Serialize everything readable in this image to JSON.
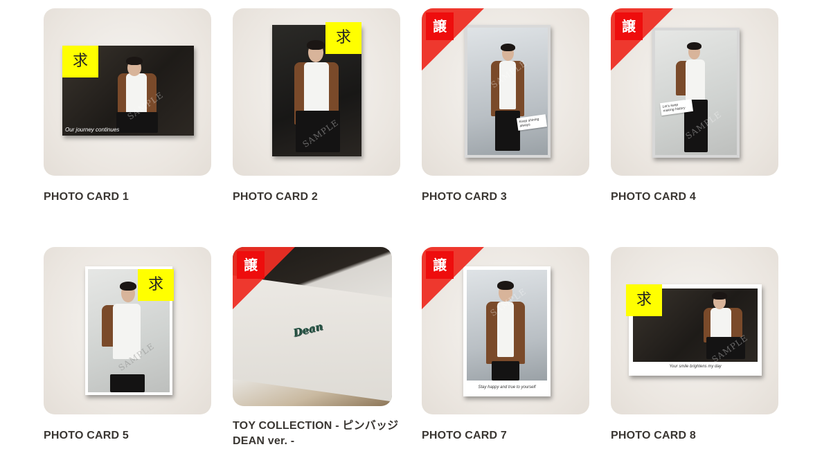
{
  "products": [
    {
      "title": "PHOTO CARD 1",
      "badge": "求",
      "badge_type": "want",
      "caption": "Our journey continues",
      "watermark": "SAMPLE"
    },
    {
      "title": "PHOTO CARD 2",
      "badge": "求",
      "badge_type": "want",
      "caption": "",
      "watermark": "SAMPLE"
    },
    {
      "title": "PHOTO CARD 3",
      "badge": "譲",
      "badge_type": "give",
      "caption": "Keep shining always",
      "watermark": "SAMPLE"
    },
    {
      "title": "PHOTO CARD 4",
      "badge": "譲",
      "badge_type": "give",
      "caption": "Let's keep making history",
      "watermark": "SAMPLE"
    },
    {
      "title": "PHOTO CARD 5",
      "badge": "求",
      "badge_type": "want",
      "caption": "",
      "watermark": "SAMPLE"
    },
    {
      "title": "TOY COLLECTION - ピンバッジ DEAN ver. -",
      "badge": "譲",
      "badge_type": "give",
      "caption": "",
      "pin_text": "Dean",
      "watermark": ""
    },
    {
      "title": "PHOTO CARD 7",
      "badge": "譲",
      "badge_type": "give",
      "caption": "Stay happy and true to yourself",
      "watermark": "SAMPLE"
    },
    {
      "title": "PHOTO CARD 8",
      "badge": "求",
      "badge_type": "want",
      "caption": "Your smile brightens my day",
      "watermark": "SAMPLE"
    }
  ],
  "colors": {
    "want_badge": "#ffff00",
    "give_badge": "#ee0d0d",
    "give_ribbon": "#ee2e24",
    "tile_bg": "#ebe6e0",
    "title_text": "#3a3632"
  }
}
